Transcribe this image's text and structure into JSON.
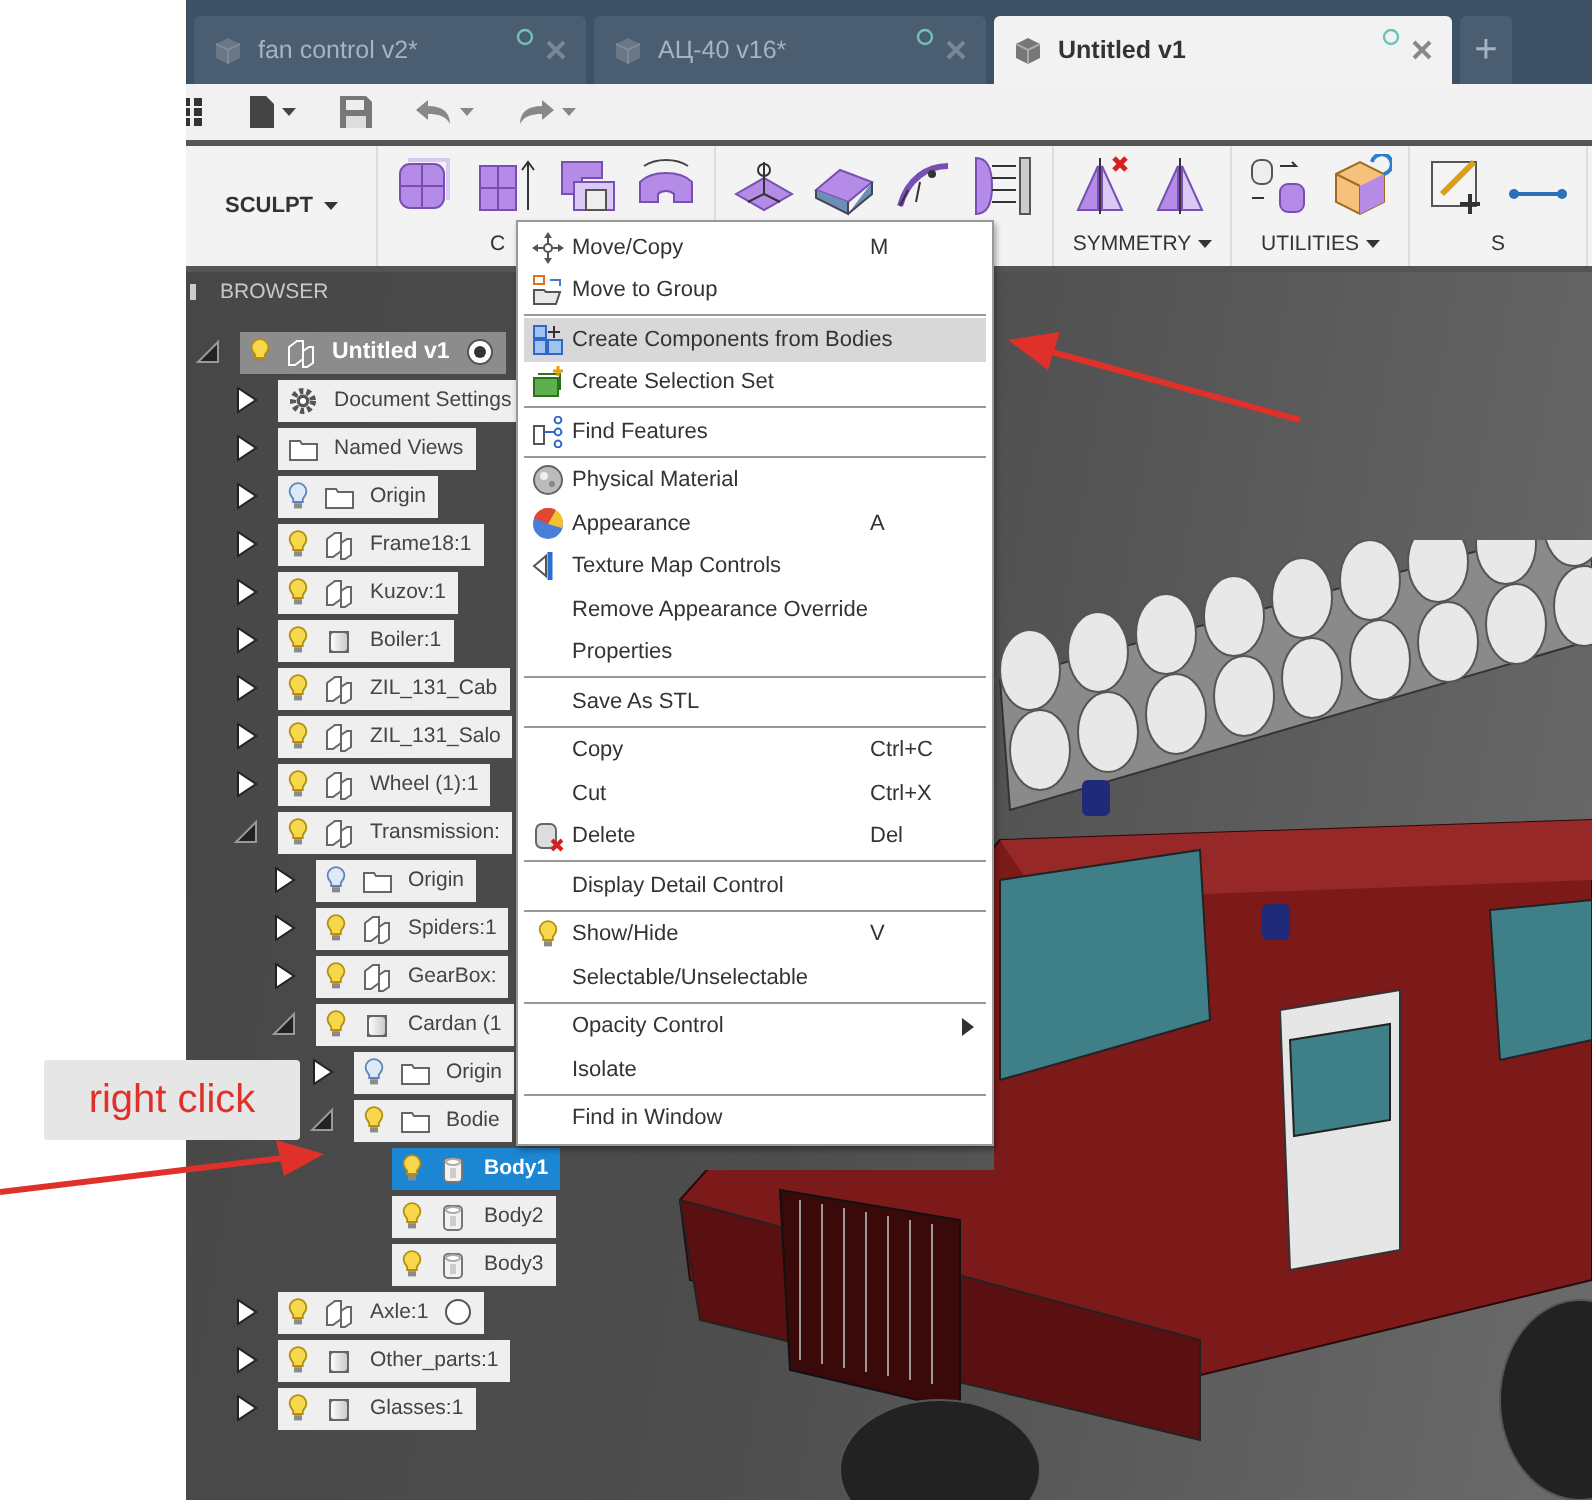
{
  "tabs": [
    {
      "label": "fan control v2*",
      "selected": false
    },
    {
      "label": "АЦ-40 v16*",
      "selected": false
    },
    {
      "label": "Untitled v1",
      "selected": true
    }
  ],
  "new_tab": "+",
  "ribbon": {
    "workspace": "SCULPT",
    "groups": [
      {
        "label": "C",
        "dropdown": false
      },
      {
        "dropdown": false
      },
      {
        "label": "SYMMETRY",
        "dropdown": true
      },
      {
        "label": "UTILITIES",
        "dropdown": true
      },
      {
        "label": "S",
        "dropdown": false
      }
    ]
  },
  "browser": {
    "title": "BROWSER",
    "tree": [
      {
        "label": "Untitled v1",
        "kind": "root",
        "expanded": true,
        "visible": true,
        "active": true,
        "selected": false,
        "children": [
          {
            "label": "Document Settings",
            "kind": "settings",
            "expanded": false,
            "selected": false
          },
          {
            "label": "Named Views",
            "kind": "folder",
            "expanded": false,
            "selected": false
          },
          {
            "label": "Origin",
            "kind": "folder",
            "expanded": false,
            "visible": false,
            "selected": false
          },
          {
            "label": "Frame18:1",
            "kind": "component",
            "expanded": false,
            "visible": true,
            "selected": false
          },
          {
            "label": "Kuzov:1",
            "kind": "component",
            "expanded": false,
            "visible": true,
            "selected": false
          },
          {
            "label": "Boiler:1",
            "kind": "part",
            "expanded": false,
            "visible": true,
            "selected": false
          },
          {
            "label": "ZIL_131_Cab",
            "kind": "component",
            "expanded": false,
            "visible": true,
            "selected": false
          },
          {
            "label": "ZIL_131_Salo",
            "kind": "component",
            "expanded": false,
            "visible": true,
            "selected": false
          },
          {
            "label": "Wheel (1):1",
            "kind": "component",
            "expanded": false,
            "visible": true,
            "selected": false
          },
          {
            "label": "Transmission:",
            "kind": "component",
            "expanded": true,
            "visible": true,
            "selected": false,
            "children": [
              {
                "label": "Origin",
                "kind": "folder",
                "expanded": false,
                "visible": false,
                "selected": false
              },
              {
                "label": "Spiders:1",
                "kind": "component",
                "expanded": false,
                "visible": true,
                "selected": false
              },
              {
                "label": "GearBox:",
                "kind": "component",
                "expanded": false,
                "visible": true,
                "selected": false
              },
              {
                "label": "Cardan (1",
                "kind": "part",
                "expanded": true,
                "visible": true,
                "selected": false,
                "children": [
                  {
                    "label": "Origin",
                    "kind": "folder",
                    "expanded": false,
                    "visible": false,
                    "selected": false
                  },
                  {
                    "label": "Bodie",
                    "kind": "folder",
                    "expanded": true,
                    "visible": true,
                    "selected": false,
                    "children": [
                      {
                        "label": "Body1",
                        "kind": "body",
                        "visible": true,
                        "selected": true
                      },
                      {
                        "label": "Body2",
                        "kind": "body",
                        "visible": true,
                        "selected": false
                      },
                      {
                        "label": "Body3",
                        "kind": "body",
                        "visible": true,
                        "selected": false
                      }
                    ]
                  }
                ]
              }
            ]
          },
          {
            "label": "Axle:1",
            "kind": "component",
            "expanded": false,
            "visible": true,
            "active": false,
            "selected": false
          },
          {
            "label": "Other_parts:1",
            "kind": "part",
            "expanded": false,
            "visible": true,
            "selected": false
          },
          {
            "label": "Glasses:1",
            "kind": "part",
            "expanded": false,
            "visible": true,
            "selected": false
          }
        ]
      }
    ]
  },
  "context_menu": [
    [
      {
        "label": "Move/Copy",
        "shortcut": "M",
        "selected": false,
        "submenu": false
      },
      {
        "label": "Move to Group",
        "selected": false,
        "submenu": false
      }
    ],
    [
      {
        "label": "Create Components from Bodies",
        "selected": true,
        "submenu": false
      },
      {
        "label": "Create Selection Set",
        "selected": false,
        "submenu": false
      }
    ],
    [
      {
        "label": "Find Features",
        "selected": false,
        "submenu": false
      }
    ],
    [
      {
        "label": "Physical Material",
        "selected": false,
        "submenu": false
      },
      {
        "label": "Appearance",
        "shortcut": "A",
        "selected": false,
        "submenu": false
      },
      {
        "label": "Texture Map Controls",
        "selected": false,
        "submenu": false
      },
      {
        "label": "Remove Appearance Override",
        "selected": false,
        "submenu": false
      },
      {
        "label": "Properties",
        "selected": false,
        "submenu": false
      }
    ],
    [
      {
        "label": "Save As STL",
        "selected": false,
        "submenu": false
      }
    ],
    [
      {
        "label": "Copy",
        "shortcut": "Ctrl+C",
        "selected": false,
        "submenu": false
      },
      {
        "label": "Cut",
        "shortcut": "Ctrl+X",
        "selected": false,
        "submenu": false
      },
      {
        "label": "Delete",
        "shortcut": "Del",
        "selected": false,
        "submenu": false
      }
    ],
    [
      {
        "label": "Display Detail Control",
        "selected": false,
        "submenu": false
      }
    ],
    [
      {
        "label": "Show/Hide",
        "shortcut": "V",
        "selected": false,
        "submenu": false
      },
      {
        "label": "Selectable/Unselectable",
        "selected": false,
        "submenu": false
      }
    ],
    [
      {
        "label": "Opacity Control",
        "selected": false,
        "submenu": true
      },
      {
        "label": "Isolate",
        "selected": false,
        "submenu": false
      }
    ],
    [
      {
        "label": "Find in Window",
        "selected": false,
        "submenu": false
      }
    ]
  ],
  "callout": {
    "text": "right click"
  }
}
